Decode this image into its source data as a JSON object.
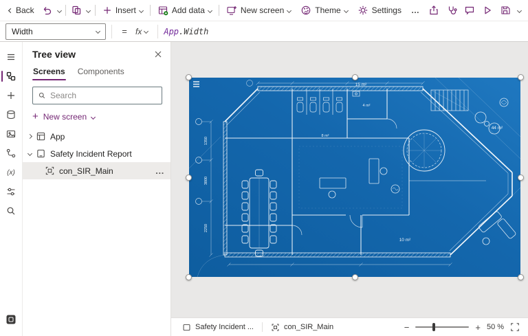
{
  "colors": {
    "accent": "#742774",
    "blueprint_blue": "#1467ad"
  },
  "toolbar": {
    "back_label": "Back",
    "insert_label": "Insert",
    "add_data_label": "Add data",
    "new_screen_label": "New screen",
    "theme_label": "Theme",
    "settings_label": "Settings",
    "overflow_label": "…"
  },
  "formula_bar": {
    "property_selector_value": "Width",
    "equals_label": "=",
    "fx_label": "fx",
    "formula_object": "App",
    "formula_member": ".Width"
  },
  "tree_panel": {
    "title": "Tree view",
    "tab_screens": "Screens",
    "tab_components": "Components",
    "search_placeholder": "Search",
    "new_screen_label": "New screen",
    "item_app_label": "App",
    "item_screen_label": "Safety Incident Report",
    "item_control_label": "con_SIR_Main",
    "overflow_label": "…"
  },
  "statusbar": {
    "screen_label": "Safety Incident ...",
    "control_label": "con_SIR_Main",
    "zoom_minus": "−",
    "zoom_plus": "+",
    "zoom_value": "50",
    "zoom_unit": "%"
  },
  "blueprint_labels": {
    "area_top": "15 m²",
    "area_small": "4 m²",
    "area_mid": "8 m²",
    "area_lounge": "44 m²",
    "area_bottom": "10 m²",
    "dim_1": "1350",
    "dim_2": "3800",
    "dim_3": "2250"
  }
}
